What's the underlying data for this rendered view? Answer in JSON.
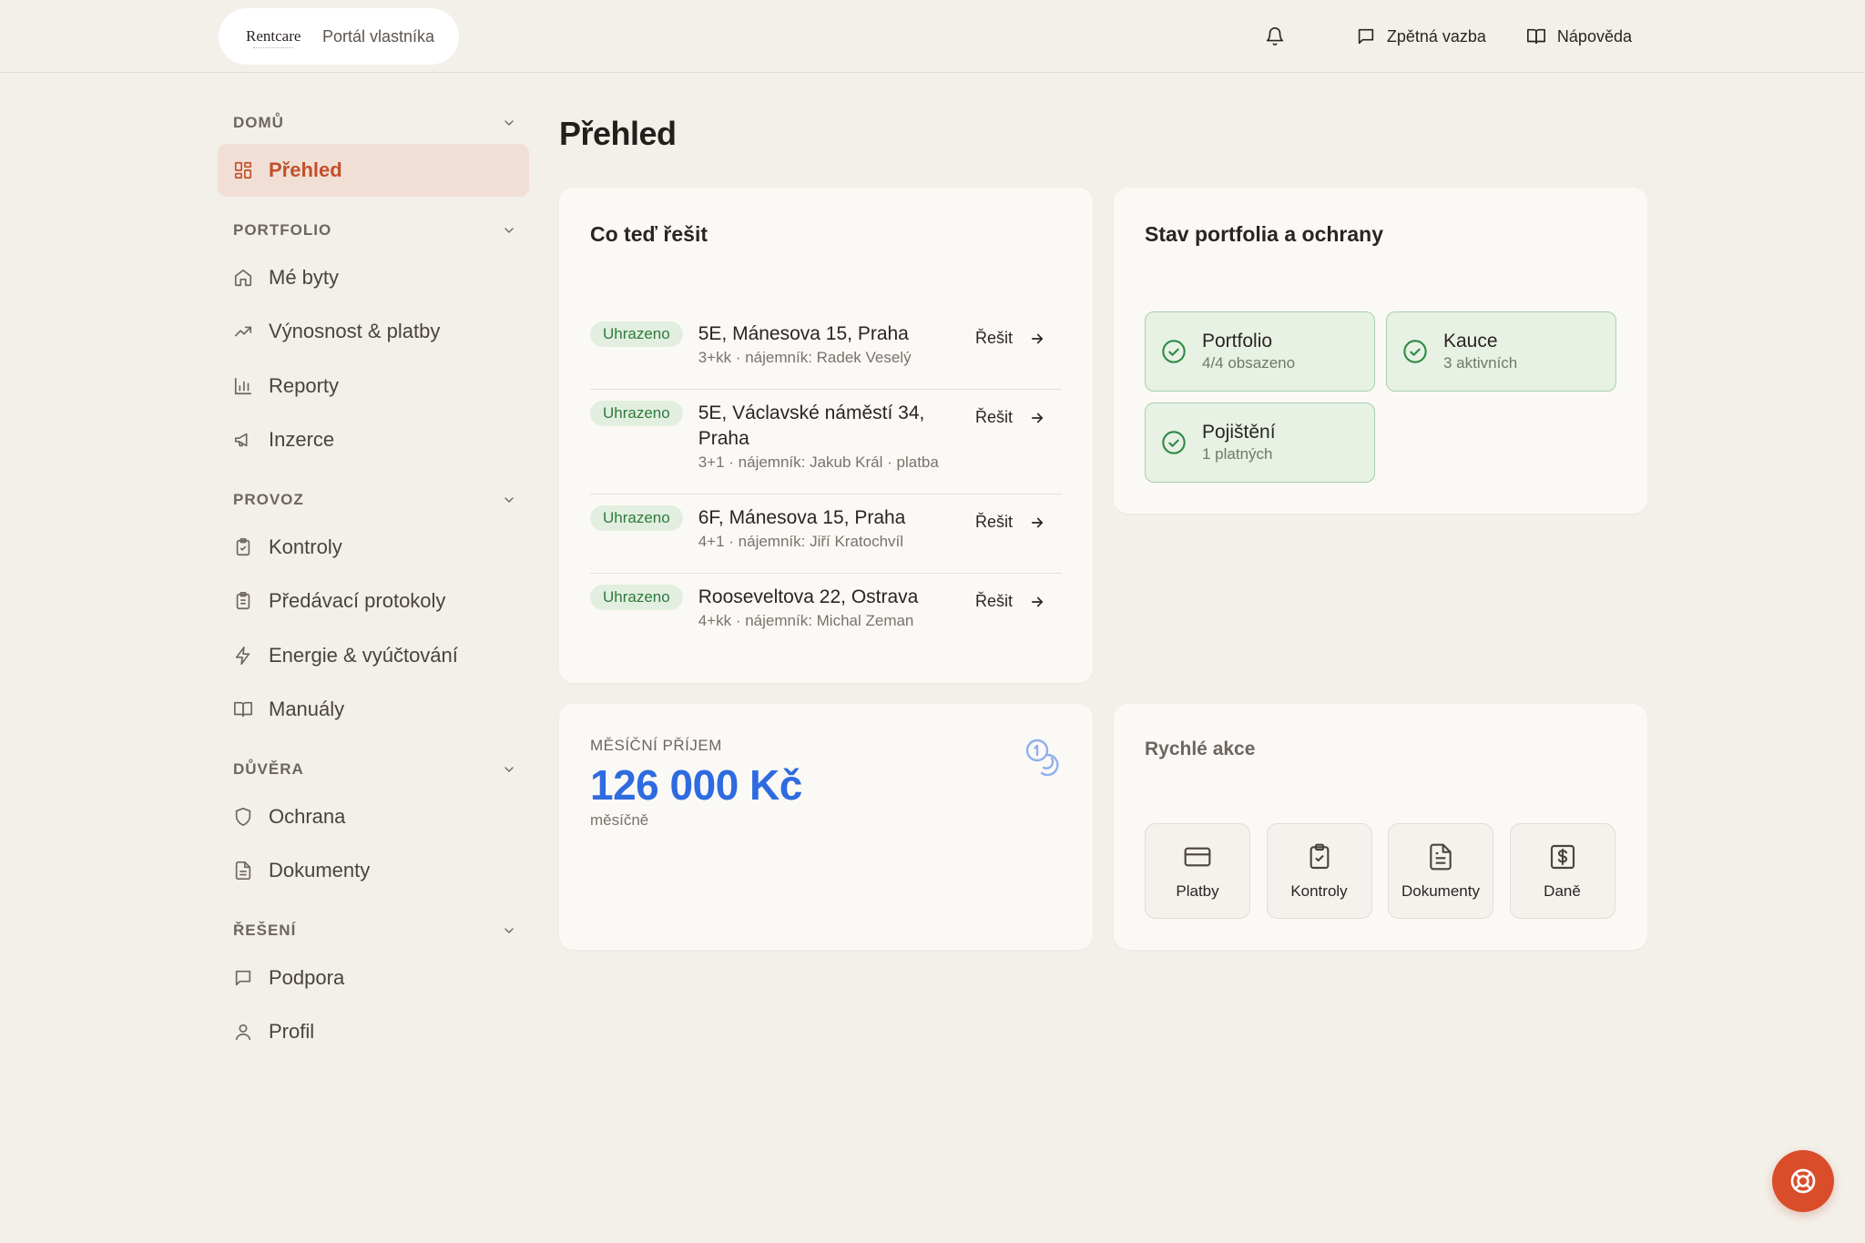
{
  "header": {
    "logo_text": "Rentcare",
    "portal_label": "Portál vlastníka",
    "feedback_label": "Zpětná vazba",
    "help_label": "Nápověda"
  },
  "sidebar": {
    "sections": [
      {
        "title": "DOMŮ",
        "items": [
          {
            "label": "Přehled",
            "icon": "dashboard-icon",
            "active": true
          }
        ]
      },
      {
        "title": "PORTFOLIO",
        "items": [
          {
            "label": "Mé byty",
            "icon": "home-icon"
          },
          {
            "label": "Výnosnost & platby",
            "icon": "trending-up-icon"
          },
          {
            "label": "Reporty",
            "icon": "bar-chart-icon"
          },
          {
            "label": "Inzerce",
            "icon": "megaphone-icon"
          }
        ]
      },
      {
        "title": "PROVOZ",
        "items": [
          {
            "label": "Kontroly",
            "icon": "clipboard-check-icon"
          },
          {
            "label": "Předávací protokoly",
            "icon": "clipboard-list-icon"
          },
          {
            "label": "Energie & vyúčtování",
            "icon": "lightning-icon"
          },
          {
            "label": "Manuály",
            "icon": "book-icon"
          }
        ]
      },
      {
        "title": "DŮVĚRA",
        "items": [
          {
            "label": "Ochrana",
            "icon": "shield-icon"
          },
          {
            "label": "Dokumenty",
            "icon": "document-icon"
          }
        ]
      },
      {
        "title": "ŘEŠENÍ",
        "items": [
          {
            "label": "Podpora",
            "icon": "chat-icon"
          },
          {
            "label": "Profil",
            "icon": "user-icon"
          }
        ]
      }
    ]
  },
  "main": {
    "page_title": "Přehled",
    "tasks": {
      "title": "Co teď řešit",
      "action_label": "Řešit",
      "items": [
        {
          "status": "Uhrazeno",
          "title": "5E, Mánesova 15, Praha",
          "subtitle": "3+kk · nájemník: Radek Veselý"
        },
        {
          "status": "Uhrazeno",
          "title": "5E, Václavské náměstí 34, Praha",
          "subtitle": "3+1 · nájemník: Jakub Král · platba"
        },
        {
          "status": "Uhrazeno",
          "title": "6F, Mánesova 15, Praha",
          "subtitle": "4+1 · nájemník: Jiří Kratochvíl"
        },
        {
          "status": "Uhrazeno",
          "title": "Rooseveltova 22, Ostrava",
          "subtitle": "4+kk · nájemník: Michal Zeman"
        }
      ]
    },
    "status": {
      "title": "Stav portfolia a ochrany",
      "tiles": [
        {
          "title": "Portfolio",
          "subtitle": "4/4 obsazeno"
        },
        {
          "title": "Kauce",
          "subtitle": "3 aktivních"
        },
        {
          "title": "Pojištění",
          "subtitle": "1 platných"
        }
      ]
    },
    "income": {
      "label": "MĚSÍČNÍ PŘÍJEM",
      "value": "126 000 Kč",
      "period": "měsíčně"
    },
    "quick_actions": {
      "title": "Rychlé akce",
      "items": [
        {
          "label": "Platby",
          "icon": "credit-card-icon"
        },
        {
          "label": "Kontroly",
          "icon": "clipboard-check-icon"
        },
        {
          "label": "Dokumenty",
          "icon": "document-icon"
        },
        {
          "label": "Daně",
          "icon": "tax-icon"
        }
      ]
    }
  },
  "colors": {
    "background": "#f3efe9",
    "accent": "#c2502a",
    "active_bg": "#f1dfd6",
    "success": "#2f7a3e",
    "income_value": "#2f6be0",
    "fab": "#d94d2a"
  }
}
